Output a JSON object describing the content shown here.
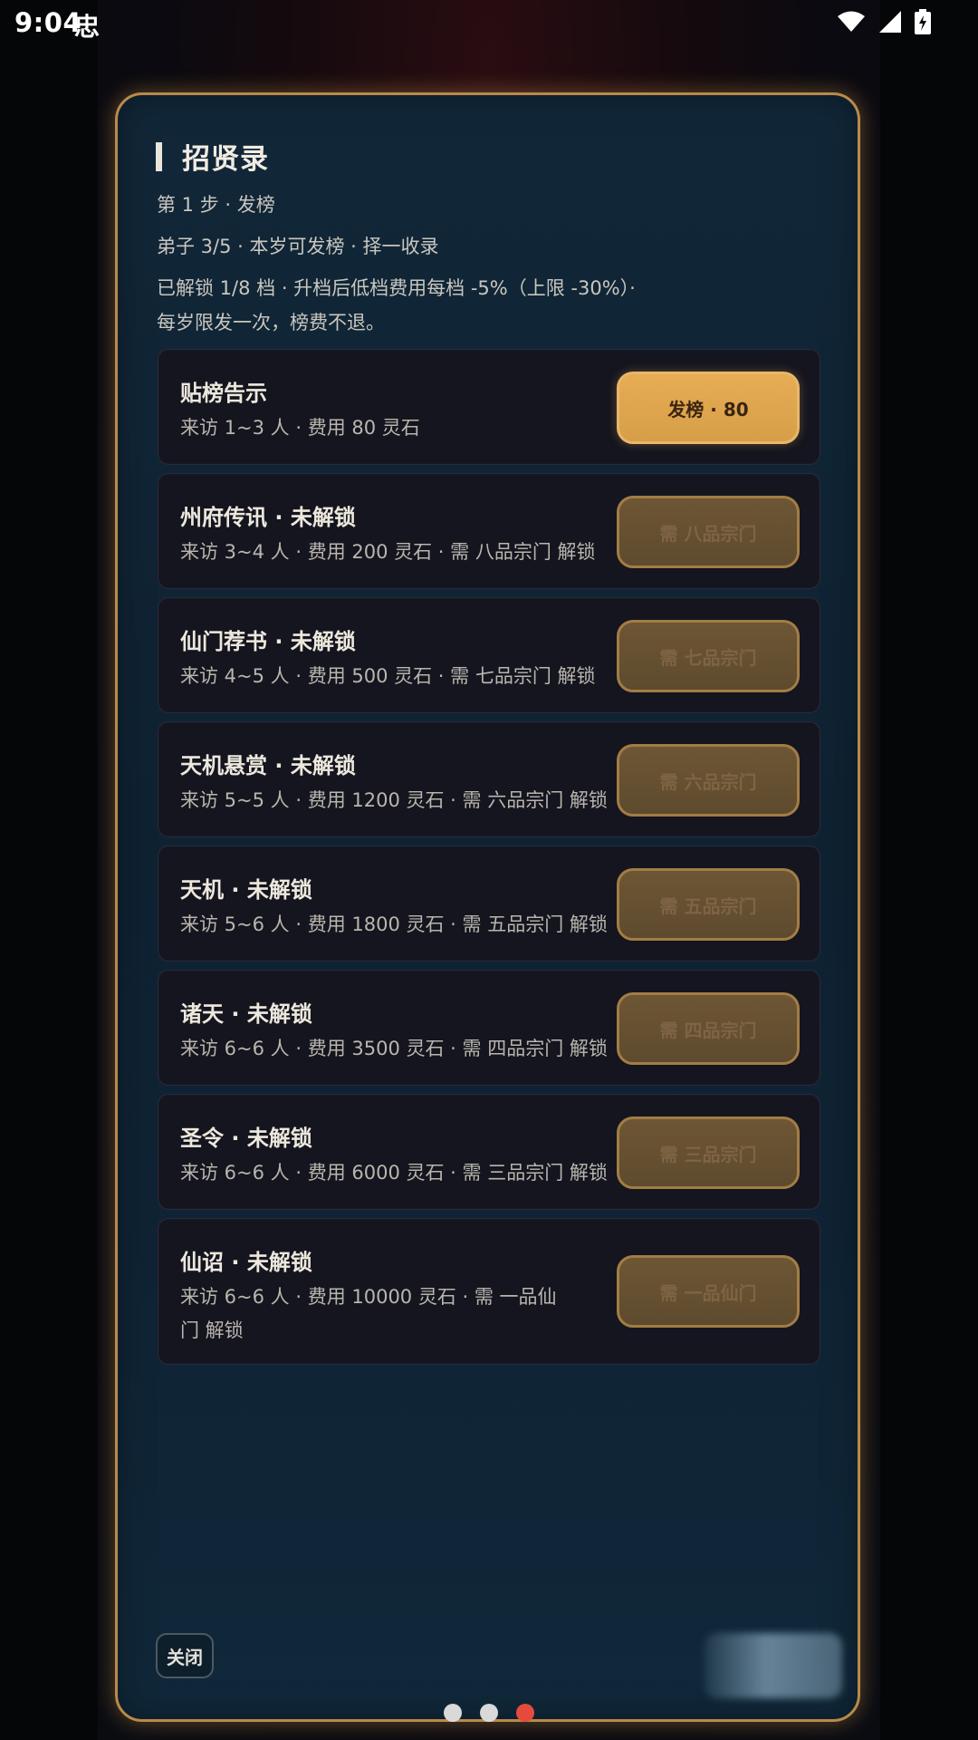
{
  "status_bar": {
    "time": "9:04",
    "bug_glyph": "忠",
    "icons": [
      "wifi-icon",
      "signal-icon",
      "battery-charging-icon"
    ]
  },
  "dialog": {
    "title": "招贤录",
    "step": "第 1 步 · 发榜",
    "disciples": "弟子 3/5 · 本岁可发榜 · 择一收录",
    "note_line1": "已解锁 1/8 档 · 升档后低档费用每档 -5%（上限 -30%）·",
    "note_line2": "每岁限发一次，榜费不退。",
    "tiers": [
      {
        "name": "贴榜告示",
        "desc": "来访 1~3 人 · 费用 80 灵石",
        "button": "发榜 · 80",
        "locked": false
      },
      {
        "name": "州府传讯 · 未解锁",
        "desc": "来访 3~4 人 · 费用 200 灵石 · 需 八品宗门 解锁",
        "button": "需 八品宗门",
        "locked": true
      },
      {
        "name": "仙门荐书 · 未解锁",
        "desc": "来访 4~5 人 · 费用 500 灵石 · 需 七品宗门 解锁",
        "button": "需 七品宗门",
        "locked": true
      },
      {
        "name": "天机悬赏 · 未解锁",
        "desc": "来访 5~5 人 · 费用 1200 灵石 · 需 六品宗门 解锁",
        "button": "需 六品宗门",
        "locked": true
      },
      {
        "name": "天机 · 未解锁",
        "desc": "来访 5~6 人 · 费用 1800 灵石 · 需 五品宗门 解锁",
        "button": "需 五品宗门",
        "locked": true
      },
      {
        "name": "诸天 · 未解锁",
        "desc": "来访 6~6 人 · 费用 3500 灵石 · 需 四品宗门 解锁",
        "button": "需 四品宗门",
        "locked": true
      },
      {
        "name": "圣令 · 未解锁",
        "desc": "来访 6~6 人 · 费用 6000 灵石 · 需 三品宗门 解锁",
        "button": "需 三品宗门",
        "locked": true
      },
      {
        "name": "仙诏 · 未解锁",
        "desc": "来访 6~6 人 · 费用 10000 灵石 · 需 一品仙门 解锁",
        "button": "需 一品仙门",
        "locked": true
      }
    ],
    "close_label": "关闭"
  },
  "pager": {
    "count": 3,
    "active_index": 2
  },
  "colors": {
    "panel_border": "#b98a4a",
    "button_active": "#e7ac54",
    "button_locked": "#6d5634",
    "dot_active": "#e54b3d"
  }
}
